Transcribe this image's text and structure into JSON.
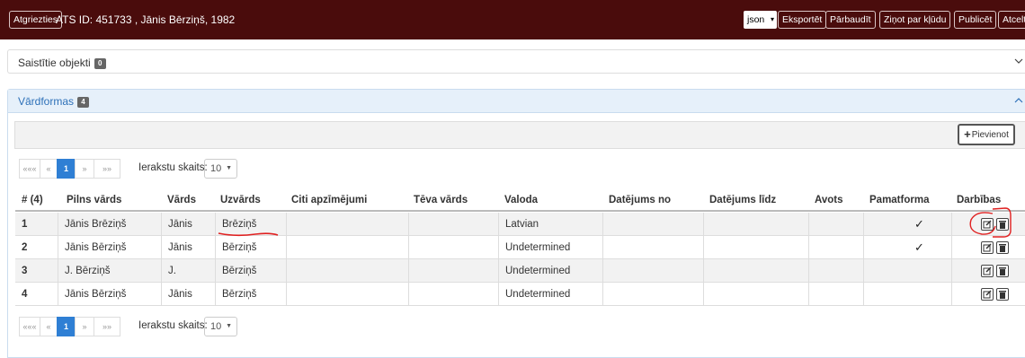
{
  "topbar": {
    "back_label": "Atgriezties",
    "title": "ATS ID: 451733 , Jānis Bērziņš, 1982",
    "format_value": "json",
    "export_label": "Eksportēt",
    "check_label": "Pārbaudīt",
    "report_label": "Ziņot par kļūdu",
    "publish_label": "Publicēt",
    "cancel_label": "Atcelt"
  },
  "linked": {
    "title": "Saistītie objekti",
    "count": "0"
  },
  "names": {
    "title": "Vārdformas",
    "count": "4",
    "add_label": "Pievienot",
    "pager": {
      "first": "«««",
      "prev": "«",
      "page": "1",
      "next": "»",
      "last": "»»",
      "count_label": "Ierakstu skaits:",
      "count_value": "10"
    },
    "columns": [
      "# (4)",
      "Pilns vārds",
      "Vārds",
      "Uzvārds",
      "Citi apzīmējumi",
      "Tēva vārds",
      "Valoda",
      "Datējums no",
      "Datējums līdz",
      "Avots",
      "Pamatforma",
      "Darbības"
    ],
    "rows": [
      {
        "num": "1",
        "full": "Jānis Brēziņš",
        "first": "Jānis",
        "last": "Brēziņš",
        "other": "",
        "father": "",
        "lang": "Latvian",
        "from": "",
        "to": "",
        "source": "",
        "primary": "✓"
      },
      {
        "num": "2",
        "full": "Jānis Bērziņš",
        "first": "Jānis",
        "last": "Bērziņš",
        "other": "",
        "father": "",
        "lang": "Undetermined",
        "from": "",
        "to": "",
        "source": "",
        "primary": "✓"
      },
      {
        "num": "3",
        "full": "J. Bērziņš",
        "first": "J.",
        "last": "Bērziņš",
        "other": "",
        "father": "",
        "lang": "Undetermined",
        "from": "",
        "to": "",
        "source": "",
        "primary": ""
      },
      {
        "num": "4",
        "full": "Jānis Bērziņš",
        "first": "Jānis",
        "last": "Bērziņš",
        "other": "",
        "father": "",
        "lang": "Undetermined",
        "from": "",
        "to": "",
        "source": "",
        "primary": ""
      }
    ]
  },
  "colors": {
    "topbar": "#4a0c0c",
    "accent": "#2f7fd4",
    "annotation": "#e02020"
  }
}
